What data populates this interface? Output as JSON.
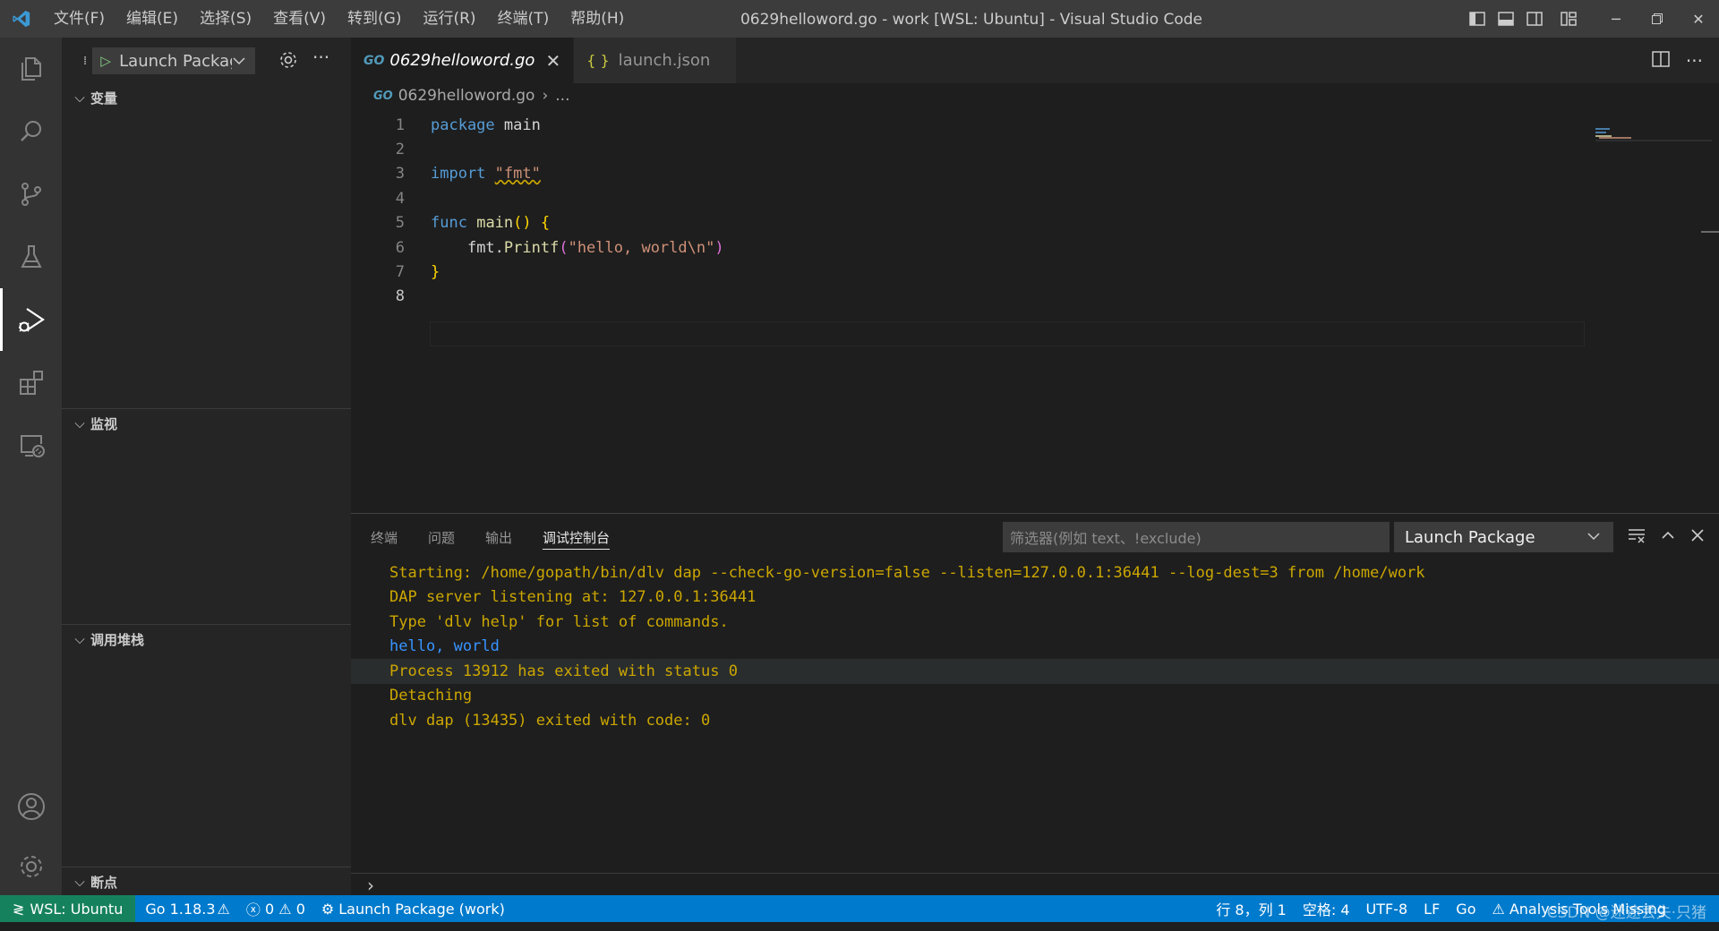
{
  "titlebar": {
    "menu": [
      "文件(F)",
      "编辑(E)",
      "选择(S)",
      "查看(V)",
      "转到(G)",
      "运行(R)",
      "终端(T)",
      "帮助(H)"
    ],
    "window_title": "0629helloword.go - work [WSL: Ubuntu] - Visual Studio Code"
  },
  "activity_icons": [
    "explorer-icon",
    "search-icon",
    "source-control-icon",
    "testing-icon",
    "run-debug-icon",
    "extensions-icon",
    "remote-explorer-icon",
    "account-icon",
    "manage-gear-icon"
  ],
  "sidebar": {
    "run_label": "Launch Packag",
    "sections": {
      "variables": "变量",
      "watch": "监视",
      "callstack": "调用堆栈",
      "breakpoints": "断点"
    }
  },
  "editor": {
    "tabs": [
      {
        "icon": "GO",
        "label": "0629helloword.go",
        "close": "✕"
      },
      {
        "icon": "{ }",
        "label": "launch.json"
      }
    ],
    "breadcrumb": {
      "file": "0629helloword.go",
      "sep": "›",
      "rest": "..."
    },
    "line_numbers": [
      "1",
      "2",
      "3",
      "4",
      "5",
      "6",
      "7",
      "8"
    ],
    "code": {
      "l1_kw": "package",
      "l1_rest": " main",
      "l3_kw": "import",
      "l3_str": "\"fmt\"",
      "l5_kw": "func",
      "l5_fn": "main",
      "l5_paren": "()",
      "l5_brace": "{",
      "l6_pkg": "fmt.",
      "l6_fn": "Printf",
      "l6_open": "(",
      "l6_str": "\"hello, world\\n\"",
      "l6_close": ")",
      "l7_brace": "}"
    }
  },
  "panel": {
    "tabs": [
      "终端",
      "问题",
      "输出",
      "调试控制台"
    ],
    "filter_placeholder": "筛选器(例如 text、!exclude)",
    "config": "Launch Package",
    "console_lines": [
      "Starting: /home/gopath/bin/dlv dap --check-go-version=false --listen=127.0.0.1:36441 --log-dest=3 from /home/work",
      "DAP server listening at: 127.0.0.1:36441",
      "Type 'dlv help' for list of commands.",
      "hello, world",
      "Process 13912 has exited with status 0",
      "Detaching",
      "dlv dap (13435) exited with code: 0"
    ],
    "prompt": "›"
  },
  "statusbar": {
    "remote": "WSL: Ubuntu",
    "go_version": "Go 1.18.3",
    "errors": "0",
    "warnings": "0",
    "debug": "Launch Package (work)",
    "position": "行 8，列 1",
    "spaces": "空格: 4",
    "encoding": "UTF-8",
    "eol": "LF",
    "language": "Go",
    "analysis": "Analysis Tools Missing",
    "watermark": "CSDN @迷途丢失·只猪"
  },
  "colors": {
    "accent": "#007acc",
    "remote": "#16825d",
    "warning_text": "#cca700",
    "output_text": "#3794ff"
  }
}
